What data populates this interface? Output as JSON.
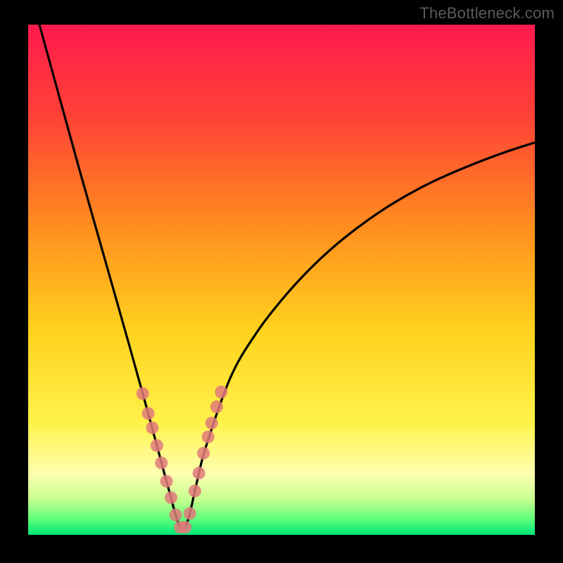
{
  "watermark": "TheBottleneck.com",
  "chart_data": {
    "type": "line",
    "title": "",
    "xlabel": "",
    "ylabel": "",
    "xlim": [
      0,
      100
    ],
    "ylim": [
      0,
      100
    ],
    "grid": false,
    "series": [
      {
        "name": "curve",
        "x": [
          0,
          5,
          10,
          15,
          20,
          23,
          25,
          27,
          28,
          29,
          30,
          31,
          32,
          33,
          35,
          40,
          45,
          50,
          55,
          60,
          65,
          70,
          75,
          80,
          85,
          90,
          95,
          100
        ],
        "values": [
          108,
          90,
          72,
          54.5,
          37,
          26.3,
          19,
          11.6,
          8,
          4.3,
          1.5,
          1.5,
          4.6,
          9,
          17,
          31,
          39.5,
          46,
          51.5,
          56.2,
          60.2,
          63.7,
          66.7,
          69.3,
          71.5,
          73.5,
          75.3,
          76.9
        ]
      }
    ],
    "markers": {
      "name": "highlight-points",
      "color": "#e07a7a",
      "x": [
        22.6,
        23.7,
        24.5,
        25.4,
        26.3,
        27.3,
        28.2,
        29.1,
        30.0,
        31.0,
        31.9,
        32.9,
        33.7,
        34.6,
        35.5,
        36.2,
        37.2,
        38.1
      ],
      "values": [
        27.7,
        23.8,
        21.0,
        17.5,
        14.1,
        10.5,
        7.3,
        3.9,
        1.5,
        1.5,
        4.2,
        8.6,
        12.1,
        16.0,
        19.2,
        21.9,
        25.1,
        28.0
      ]
    },
    "background_gradient": {
      "stops": [
        {
          "offset": 0.0,
          "color": "#ff1a4d"
        },
        {
          "offset": 0.18,
          "color": "#ff4236"
        },
        {
          "offset": 0.4,
          "color": "#ff8f1e"
        },
        {
          "offset": 0.6,
          "color": "#ffd21e"
        },
        {
          "offset": 0.78,
          "color": "#fff24a"
        },
        {
          "offset": 0.88,
          "color": "#fdffb0"
        },
        {
          "offset": 0.93,
          "color": "#c8ff8f"
        },
        {
          "offset": 0.97,
          "color": "#5cff7a"
        },
        {
          "offset": 1.0,
          "color": "#00e676"
        }
      ]
    }
  }
}
